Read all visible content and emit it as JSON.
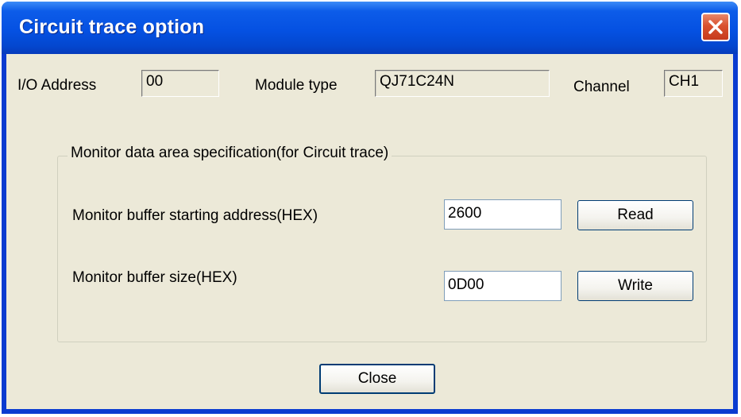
{
  "window": {
    "title": "Circuit trace option",
    "close_icon": "close-icon"
  },
  "info": {
    "io_address_label": "I/O Address",
    "io_address_value": "00",
    "module_type_label": "Module type",
    "module_type_value": "QJ71C24N",
    "channel_label": "Channel",
    "channel_value": "CH1"
  },
  "group": {
    "caption": "Monitor data area specification(for Circuit trace)",
    "start_address_label": "Monitor buffer starting address(HEX)",
    "start_address_value": "2600",
    "size_label": "Monitor buffer size(HEX)",
    "size_value": "0D00",
    "read_label": "Read",
    "write_label": "Write"
  },
  "footer": {
    "close_label": "Close"
  },
  "colors": {
    "titlebar": "#0551e2",
    "dialog_bg": "#ece9d8",
    "close_button": "#d9512f"
  }
}
